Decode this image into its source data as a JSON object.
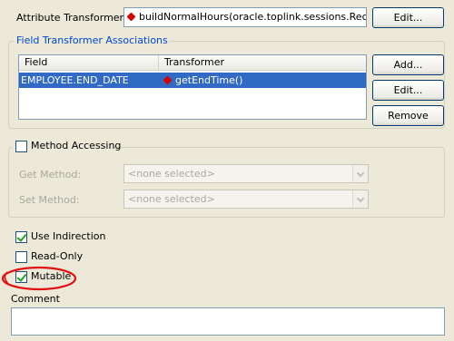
{
  "attribute_transformer": {
    "label": "Attribute Transformer:",
    "value": "buildNormalHours(oracle.toplink.sessions.Record...",
    "edit_label": "Edit..."
  },
  "field_transformers": {
    "title": "Field Transformer Associations",
    "columns": [
      "Field",
      "Transformer"
    ],
    "rows": [
      {
        "field": "EMPLOYEE.END_DATE",
        "transformer": "getEndTime()"
      }
    ],
    "add_label": "Add...",
    "edit_label": "Edit...",
    "remove_label": "Remove"
  },
  "method_accessing": {
    "label": "Method Accessing",
    "checked": false,
    "get_label": "Get Method:",
    "get_value": "<none selected>",
    "set_label": "Set Method:",
    "set_value": "<none selected>"
  },
  "options": {
    "use_indirection": {
      "label": "Use Indirection",
      "checked": true
    },
    "read_only": {
      "label": "Read-Only",
      "checked": false
    },
    "mutable": {
      "label": "Mutable",
      "checked": true
    }
  },
  "comment": {
    "label": "Comment",
    "value": ""
  },
  "colors": {
    "highlight_ellipse": "#e01010",
    "selection": "#316ac5",
    "method_gem": "#d40000"
  }
}
